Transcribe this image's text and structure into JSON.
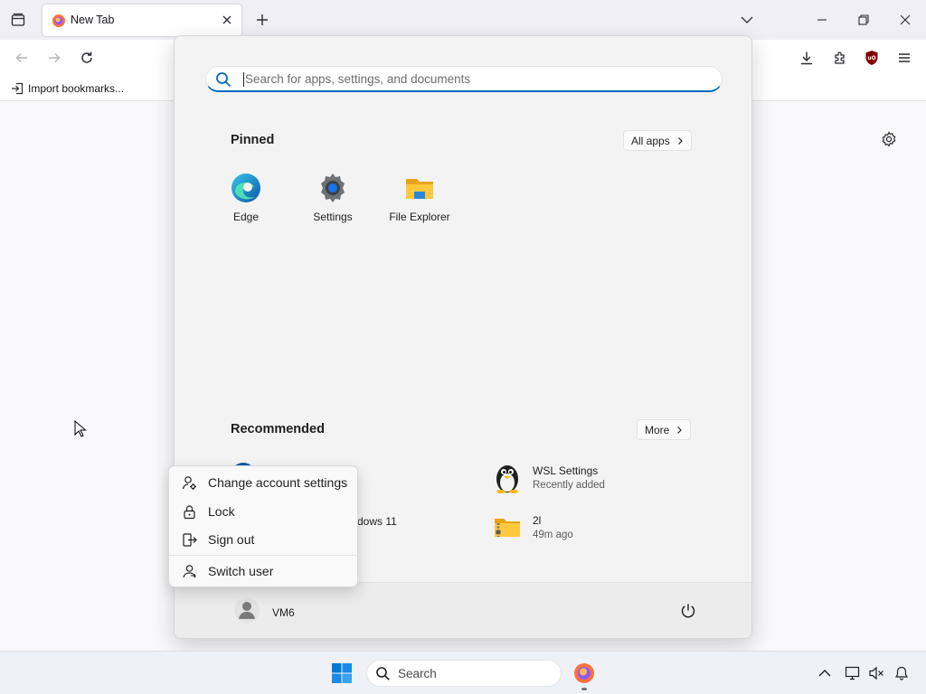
{
  "browser": {
    "tab": {
      "title": "New Tab"
    },
    "bookmarks": {
      "import_label": "Import bookmarks..."
    }
  },
  "start_menu": {
    "search_placeholder": "Search for apps, settings, and documents",
    "pinned": {
      "title": "Pinned",
      "all_apps_label": "All apps",
      "apps": [
        {
          "label": "Edge",
          "icon": "edge-icon"
        },
        {
          "label": "Settings",
          "icon": "settings-gear-icon"
        },
        {
          "label": "File Explorer",
          "icon": "file-explorer-icon"
        }
      ]
    },
    "recommended": {
      "title": "Recommended",
      "more_label": "More",
      "items": [
        {
          "name": "dows 11",
          "subtitle": ""
        },
        {
          "name": "WSL Settings",
          "subtitle": "Recently added",
          "icon": "tux-penguin-icon"
        },
        {
          "name": "2l",
          "subtitle": "49m ago",
          "icon": "zip-folder-icon"
        }
      ]
    },
    "user": {
      "name": "VM6"
    },
    "context_menu": {
      "items": [
        {
          "label": "Change account settings",
          "icon": "account-settings-icon"
        },
        {
          "label": "Lock",
          "icon": "lock-icon"
        },
        {
          "label": "Sign out",
          "icon": "sign-out-icon"
        },
        {
          "label": "Switch user",
          "icon": "switch-user-icon"
        }
      ]
    }
  },
  "taskbar": {
    "search_label": "Search"
  },
  "colors": {
    "accent": "#0067c0",
    "ublock": "#800000",
    "firefox": "#ff7139"
  }
}
